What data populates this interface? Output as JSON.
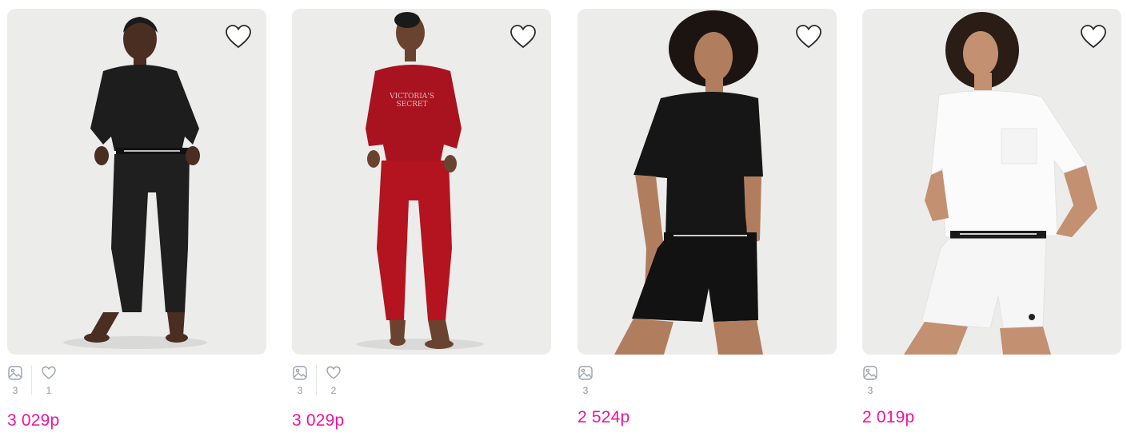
{
  "products": [
    {
      "price": "3 029р",
      "photo_count": "3",
      "like_count": "1",
      "outfit": "black-long-sleeve-joggers",
      "colors": {
        "top": "#1d1d1d",
        "bottom": "#1f1f1f",
        "skin": "#4a2e22"
      }
    },
    {
      "price": "3 029р",
      "photo_count": "3",
      "like_count": "2",
      "outfit": "red-sweatshirt-joggers",
      "colors": {
        "top": "#a8131f",
        "bottom": "#b3141f",
        "skin": "#6a4330"
      }
    },
    {
      "price": "2 524р",
      "photo_count": "3",
      "like_count": null,
      "outfit": "black-tee-shorts",
      "colors": {
        "top": "#161616",
        "bottom": "#121212",
        "skin": "#b07e5e"
      }
    },
    {
      "price": "2 019р",
      "photo_count": "3",
      "like_count": null,
      "outfit": "white-tee-shorts",
      "colors": {
        "top": "#fbfbfb",
        "bottom": "#f6f6f6",
        "skin": "#c39072"
      }
    }
  ],
  "icons": {
    "favorite": "heart-outline-icon",
    "photos": "image-icon",
    "likes": "heart-small-icon"
  },
  "accent_color": "#f0149a"
}
